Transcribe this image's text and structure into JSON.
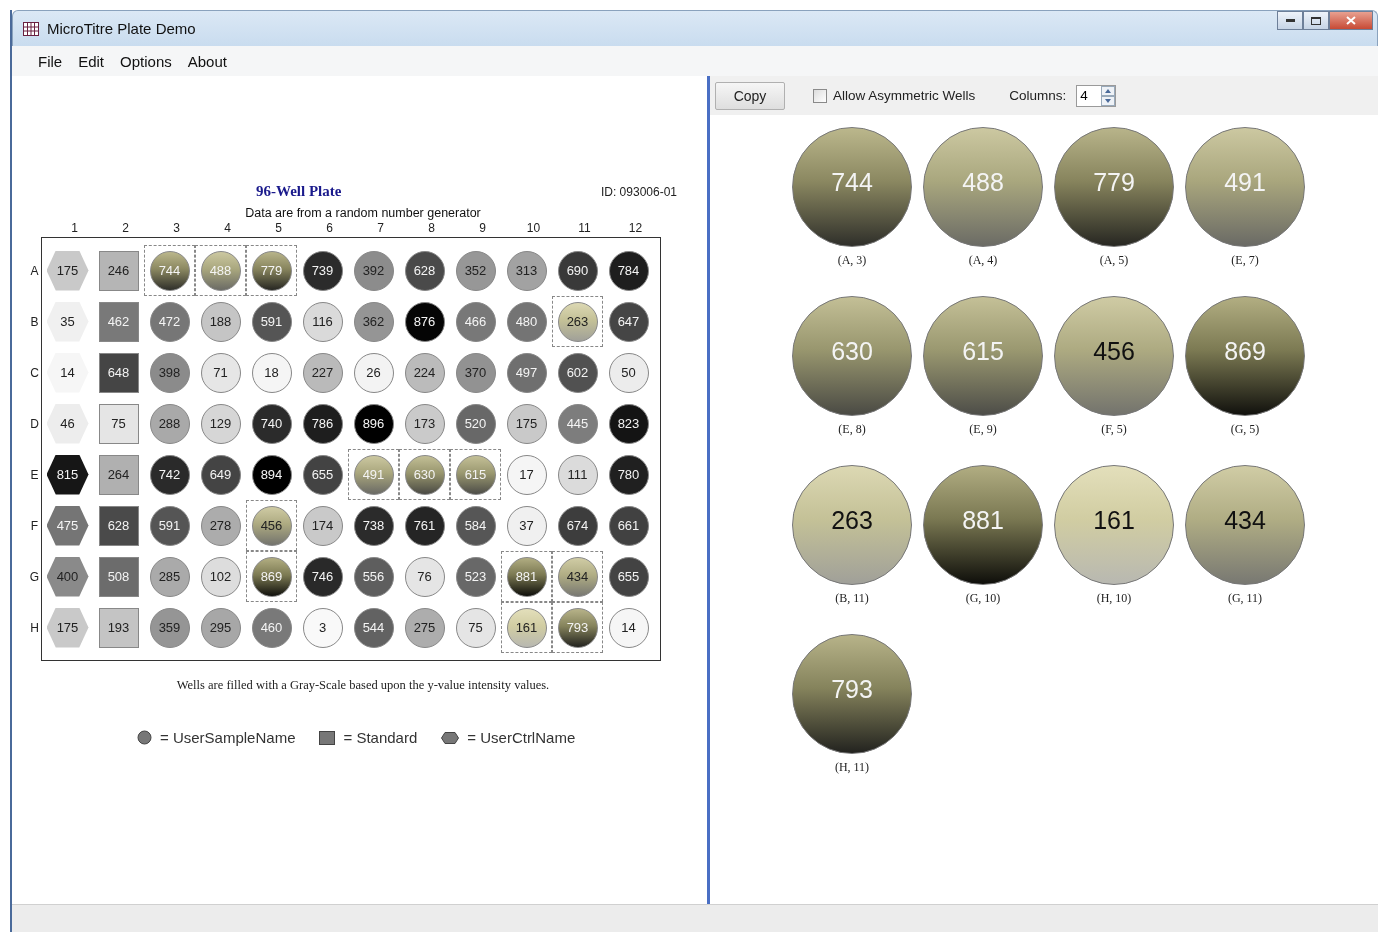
{
  "window": {
    "title": "MicroTitre Plate Demo"
  },
  "menu": [
    "File",
    "Edit",
    "Options",
    "About"
  ],
  "plate": {
    "title": "96-Well Plate",
    "id": "ID: 093006-01",
    "subtitle": "Data are from a random number generator",
    "columns": [
      {
        "label": "1",
        "kind": "control"
      },
      {
        "label": "2",
        "kind": "standard"
      },
      {
        "label": "3",
        "kind": "sample"
      },
      {
        "label": "4",
        "kind": "sample"
      },
      {
        "label": "5",
        "kind": "sample"
      },
      {
        "label": "6",
        "kind": "sample"
      },
      {
        "label": "7",
        "kind": "sample"
      },
      {
        "label": "8",
        "kind": "sample"
      },
      {
        "label": "9",
        "kind": "sample"
      },
      {
        "label": "10",
        "kind": "sample"
      },
      {
        "label": "11",
        "kind": "sample"
      },
      {
        "label": "12",
        "kind": "sample"
      }
    ],
    "rows": [
      {
        "label": "A",
        "wells": [
          {
            "value": "175",
            "selected": false
          },
          {
            "value": "246",
            "selected": false
          },
          {
            "value": "744",
            "selected": true
          },
          {
            "value": "488",
            "selected": true
          },
          {
            "value": "779",
            "selected": true
          },
          {
            "value": "739",
            "selected": false
          },
          {
            "value": "392",
            "selected": false
          },
          {
            "value": "628",
            "selected": false
          },
          {
            "value": "352",
            "selected": false
          },
          {
            "value": "313",
            "selected": false
          },
          {
            "value": "690",
            "selected": false
          },
          {
            "value": "784",
            "selected": false
          }
        ]
      },
      {
        "label": "B",
        "wells": [
          {
            "value": "35",
            "selected": false
          },
          {
            "value": "462",
            "selected": false
          },
          {
            "value": "472",
            "selected": false
          },
          {
            "value": "188",
            "selected": false
          },
          {
            "value": "591",
            "selected": false
          },
          {
            "value": "116",
            "selected": false
          },
          {
            "value": "362",
            "selected": false
          },
          {
            "value": "876",
            "selected": false
          },
          {
            "value": "466",
            "selected": false
          },
          {
            "value": "480",
            "selected": false
          },
          {
            "value": "263",
            "selected": true
          },
          {
            "value": "647",
            "selected": false
          }
        ]
      },
      {
        "label": "C",
        "wells": [
          {
            "value": "14",
            "selected": false
          },
          {
            "value": "648",
            "selected": false
          },
          {
            "value": "398",
            "selected": false
          },
          {
            "value": "71",
            "selected": false
          },
          {
            "value": "18",
            "selected": false
          },
          {
            "value": "227",
            "selected": false
          },
          {
            "value": "26",
            "selected": false
          },
          {
            "value": "224",
            "selected": false
          },
          {
            "value": "370",
            "selected": false
          },
          {
            "value": "497",
            "selected": false
          },
          {
            "value": "602",
            "selected": false
          },
          {
            "value": "50",
            "selected": false
          }
        ]
      },
      {
        "label": "D",
        "wells": [
          {
            "value": "46",
            "selected": false
          },
          {
            "value": "75",
            "selected": false
          },
          {
            "value": "288",
            "selected": false
          },
          {
            "value": "129",
            "selected": false
          },
          {
            "value": "740",
            "selected": false
          },
          {
            "value": "786",
            "selected": false
          },
          {
            "value": "896",
            "selected": false
          },
          {
            "value": "173",
            "selected": false
          },
          {
            "value": "520",
            "selected": false
          },
          {
            "value": "175",
            "selected": false
          },
          {
            "value": "445",
            "selected": false
          },
          {
            "value": "823",
            "selected": false
          }
        ]
      },
      {
        "label": "E",
        "wells": [
          {
            "value": "815",
            "selected": false
          },
          {
            "value": "264",
            "selected": false
          },
          {
            "value": "742",
            "selected": false
          },
          {
            "value": "649",
            "selected": false
          },
          {
            "value": "894",
            "selected": false
          },
          {
            "value": "655",
            "selected": false
          },
          {
            "value": "491",
            "selected": true
          },
          {
            "value": "630",
            "selected": true
          },
          {
            "value": "615",
            "selected": true
          },
          {
            "value": "17",
            "selected": false
          },
          {
            "value": "111",
            "selected": false
          },
          {
            "value": "780",
            "selected": false
          }
        ]
      },
      {
        "label": "F",
        "wells": [
          {
            "value": "475",
            "selected": false
          },
          {
            "value": "628",
            "selected": false
          },
          {
            "value": "591",
            "selected": false
          },
          {
            "value": "278",
            "selected": false
          },
          {
            "value": "456",
            "selected": true
          },
          {
            "value": "174",
            "selected": false
          },
          {
            "value": "738",
            "selected": false
          },
          {
            "value": "761",
            "selected": false
          },
          {
            "value": "584",
            "selected": false
          },
          {
            "value": "37",
            "selected": false
          },
          {
            "value": "674",
            "selected": false
          },
          {
            "value": "661",
            "selected": false
          }
        ]
      },
      {
        "label": "G",
        "wells": [
          {
            "value": "400",
            "selected": false
          },
          {
            "value": "508",
            "selected": false
          },
          {
            "value": "285",
            "selected": false
          },
          {
            "value": "102",
            "selected": false
          },
          {
            "value": "869",
            "selected": true
          },
          {
            "value": "746",
            "selected": false
          },
          {
            "value": "556",
            "selected": false
          },
          {
            "value": "76",
            "selected": false
          },
          {
            "value": "523",
            "selected": false
          },
          {
            "value": "881",
            "selected": true
          },
          {
            "value": "434",
            "selected": true
          },
          {
            "value": "655",
            "selected": false
          }
        ]
      },
      {
        "label": "H",
        "wells": [
          {
            "value": "175",
            "selected": false
          },
          {
            "value": "193",
            "selected": false
          },
          {
            "value": "359",
            "selected": false
          },
          {
            "value": "295",
            "selected": false
          },
          {
            "value": "460",
            "selected": false
          },
          {
            "value": "3",
            "selected": false
          },
          {
            "value": "544",
            "selected": false
          },
          {
            "value": "275",
            "selected": false
          },
          {
            "value": "75",
            "selected": false
          },
          {
            "value": "161",
            "selected": true
          },
          {
            "value": "793",
            "selected": true
          },
          {
            "value": "14",
            "selected": false
          }
        ]
      }
    ],
    "note": "Wells are filled with a Gray-Scale based upon the y-value intensity values.",
    "legend": [
      {
        "kind": "sample",
        "label": "= UserSampleName"
      },
      {
        "kind": "standard",
        "label": "= Standard"
      },
      {
        "kind": "control",
        "label": "= UserCtrlName"
      }
    ]
  },
  "detail": {
    "copy_button": "Copy",
    "asymmetric": {
      "label": "Allow Asymmetric Wells",
      "checked": false
    },
    "columns_label": "Columns:",
    "columns_value": "4",
    "wells": [
      {
        "value": "744",
        "label": "(A, 3)"
      },
      {
        "value": "488",
        "label": "(A, 4)"
      },
      {
        "value": "779",
        "label": "(A, 5)"
      },
      {
        "value": "491",
        "label": "(E, 7)"
      },
      {
        "value": "630",
        "label": "(E, 8)"
      },
      {
        "value": "615",
        "label": "(E, 9)"
      },
      {
        "value": "456",
        "label": "(F, 5)"
      },
      {
        "value": "869",
        "label": "(G, 5)"
      },
      {
        "value": "263",
        "label": "(B, 11)"
      },
      {
        "value": "881",
        "label": "(G, 10)"
      },
      {
        "value": "161",
        "label": "(H, 10)"
      },
      {
        "value": "434",
        "label": "(G, 11)"
      },
      {
        "value": "793",
        "label": "(H, 11)"
      }
    ]
  }
}
